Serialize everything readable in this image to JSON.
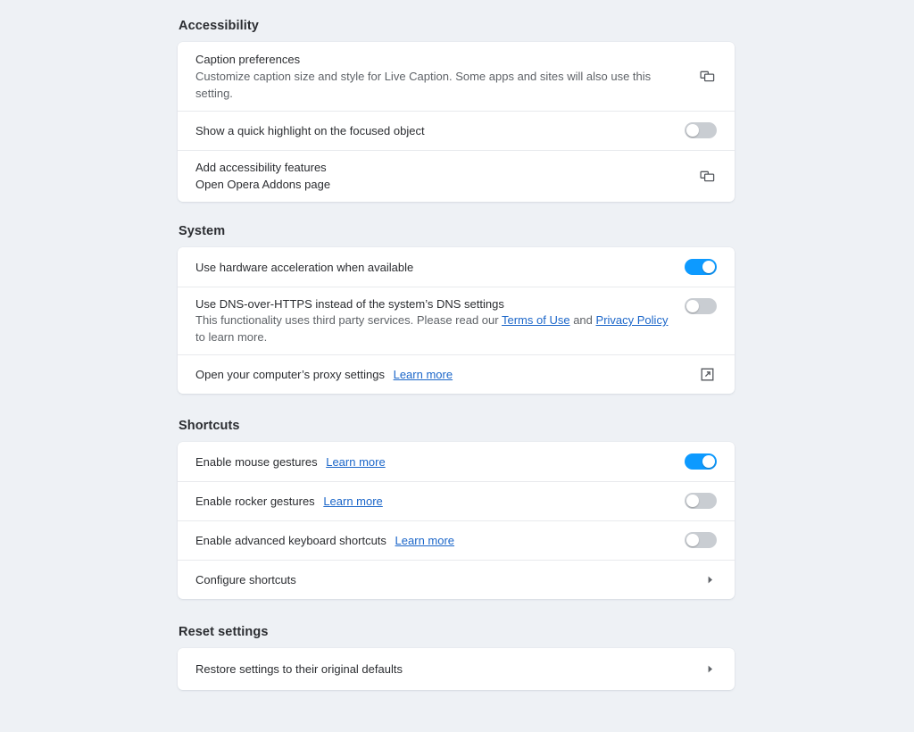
{
  "theme": {
    "page_background": "#eef1f5",
    "card_background": "#ffffff",
    "accent_on": "#0d9aff",
    "toggle_off": "#c9cdd2",
    "link_color": "#1b66c9",
    "text_primary": "#2b2d31",
    "text_secondary": "#5f6368"
  },
  "sections": {
    "accessibility": {
      "title": "Accessibility",
      "rows": {
        "caption_preferences": {
          "title": "Caption preferences",
          "subtitle": "Customize caption size and style for Live Caption. Some apps and sites will also use this setting.",
          "control": "open-window-icon"
        },
        "focus_highlight": {
          "title": "Show a quick highlight on the focused object",
          "toggle_state": "off"
        },
        "add_features": {
          "title": "Add accessibility features",
          "subtitle": "Open Opera Addons page",
          "control": "open-window-icon"
        }
      }
    },
    "system": {
      "title": "System",
      "rows": {
        "hardware_acceleration": {
          "title": "Use hardware acceleration when available",
          "toggle_state": "on"
        },
        "dns_over_https": {
          "title": "Use DNS-over-HTTPS instead of the system’s DNS settings",
          "sub_part1": "This functionality uses third party services. Please read our",
          "link1": "Terms of Use",
          "sub_part2": "and",
          "link2": "Privacy Policy",
          "sub_part3": "to learn more.",
          "toggle_state": "off"
        },
        "proxy_settings": {
          "title": "Open your computer’s proxy settings",
          "link": "Learn more",
          "control": "external-link-icon"
        }
      }
    },
    "shortcuts": {
      "title": "Shortcuts",
      "rows": {
        "mouse_gestures": {
          "title": "Enable mouse gestures",
          "link": "Learn more",
          "toggle_state": "on"
        },
        "rocker_gestures": {
          "title": "Enable rocker gestures",
          "link": "Learn more",
          "toggle_state": "off"
        },
        "advanced_keyboard": {
          "title": "Enable advanced keyboard shortcuts",
          "link": "Learn more",
          "toggle_state": "off"
        },
        "configure_shortcuts": {
          "title": "Configure shortcuts",
          "control": "chevron-right-icon"
        }
      }
    },
    "reset": {
      "title": "Reset settings",
      "rows": {
        "restore_defaults": {
          "title": "Restore settings to their original defaults",
          "control": "chevron-right-icon"
        }
      }
    }
  }
}
